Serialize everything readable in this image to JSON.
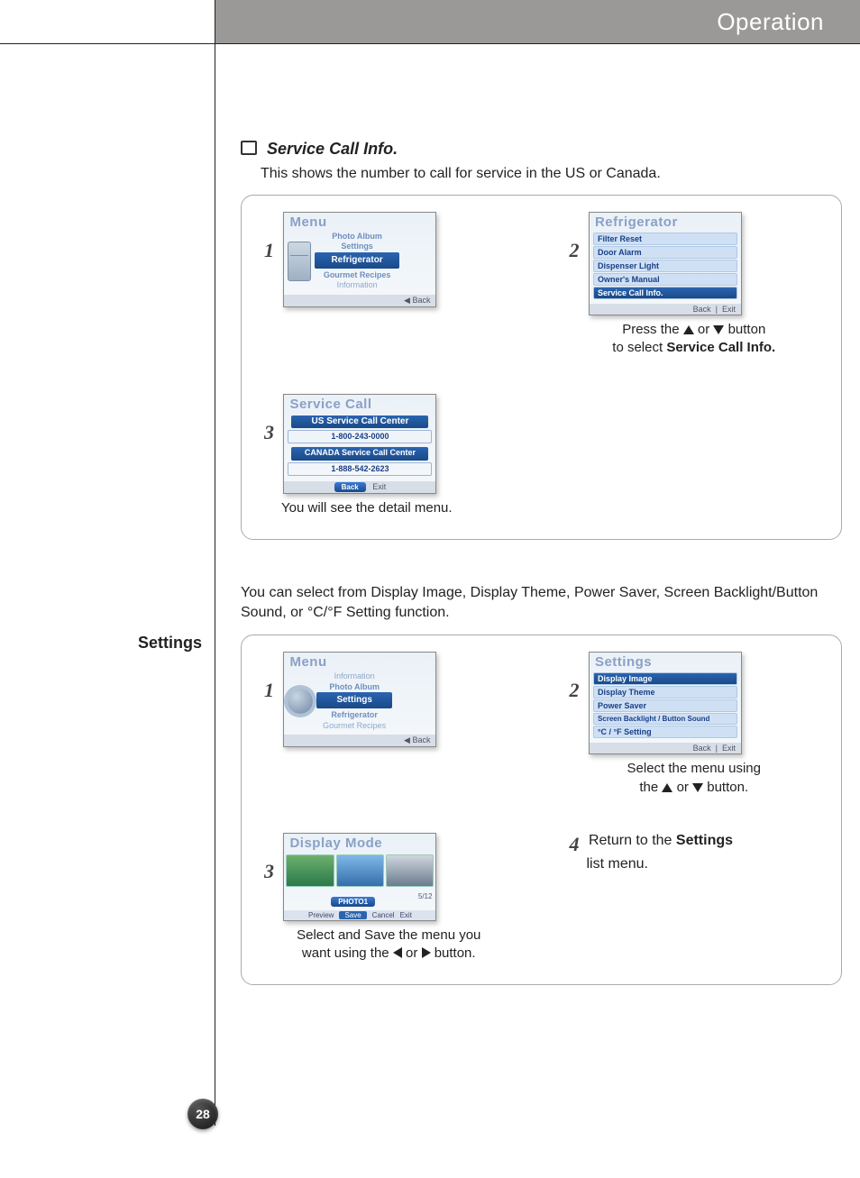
{
  "header": {
    "title": "Operation"
  },
  "sideLabel": "Settings",
  "pageNumber": "28",
  "serviceCall": {
    "heading": "Service Call Info.",
    "intro": "This shows the number to call for service in the US or Canada.",
    "step1": {
      "no": "1"
    },
    "step2": {
      "no": "2",
      "caption_pre": "Press the ",
      "caption_mid": " or ",
      "caption_post": " button",
      "caption_line2_pre": "to select ",
      "caption_bold": "Service Call Info."
    },
    "step3": {
      "no": "3",
      "caption": "You will see the detail menu."
    },
    "screen1": {
      "title": "Menu",
      "items": [
        "Photo Album",
        "Settings",
        "Refrigerator",
        "Gourmet Recipes",
        "Information"
      ],
      "foot": "◀ Back"
    },
    "screen2": {
      "title": "Refrigerator",
      "items": [
        "Filter Reset",
        "Door Alarm",
        "Dispenser Light",
        "Owner's Manual",
        "Service Call Info."
      ],
      "foot_back": "Back",
      "foot_exit": "Exit"
    },
    "screen3": {
      "title": "Service Call",
      "us_head": "US Service Call Center",
      "us_no": "1-800-243-0000",
      "ca_head": "CANADA Service Call Center",
      "ca_no": "1-888-542-2623",
      "foot_back": "Back",
      "foot_exit": "Exit"
    }
  },
  "settings": {
    "intro": "You can select from Display Image, Display Theme, Power Saver, Screen Backlight/Button Sound, or °C/°F Setting function.",
    "step1": {
      "no": "1"
    },
    "step2": {
      "no": "2",
      "caption_pre": "Select the menu using",
      "caption_line2_pre": "the ",
      "caption_mid": "or ",
      "caption_post": "button."
    },
    "step3": {
      "no": "3",
      "caption_l1": "Select and Save the menu you",
      "caption_l2_pre": "want using the ",
      "caption_l2_mid": " or ",
      "caption_l2_post": " button."
    },
    "step4": {
      "no": "4",
      "text_pre": "Return to the ",
      "text_bold": "Settings",
      "text_post": " list menu."
    },
    "screen1": {
      "title": "Menu",
      "items": [
        "Information",
        "Photo Album",
        "Settings",
        "Refrigerator",
        "Gourmet Recipes"
      ],
      "foot": "◀ Back"
    },
    "screen2": {
      "title": "Settings",
      "items": [
        "Display Image",
        "Display Theme",
        "Power Saver",
        "Screen Backlight / Button Sound",
        "°C / °F Setting"
      ],
      "foot_back": "Back",
      "foot_exit": "Exit"
    },
    "screen3": {
      "title": "Display Mode",
      "selected": "PHOTO1",
      "counter": "5/12",
      "buttons": [
        "Preview",
        "Save",
        "Cancel",
        "Exit"
      ]
    }
  }
}
